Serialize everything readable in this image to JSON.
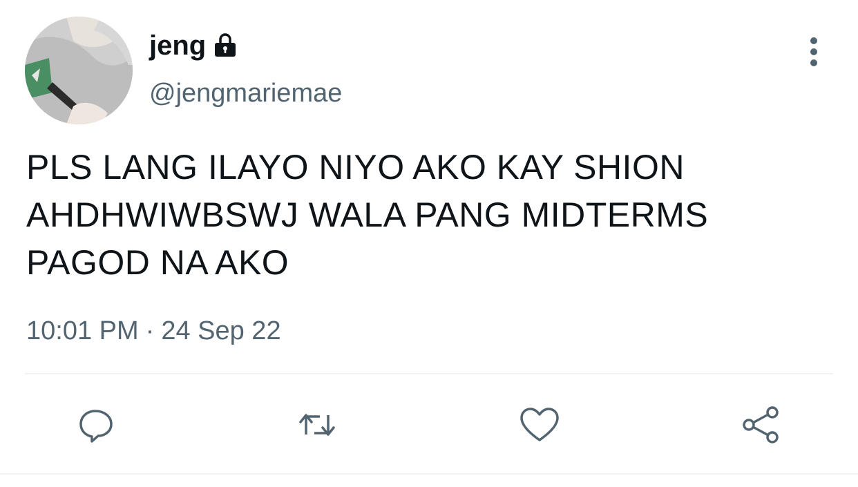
{
  "author": {
    "display_name": "jeng",
    "handle": "@jengmariemae",
    "protected_icon": "lock-icon",
    "avatar_icon": "profile-photo"
  },
  "tweet": {
    "text": "PLS LANG ILAYO NIYO AKO KAY SHION AHDHWIWBSWJ WALA PANG MIDTERMS PAGOD NA AKO",
    "time": "10:01 PM",
    "separator": "·",
    "date": "24 Sep 22"
  },
  "actions": {
    "reply": "reply-icon",
    "retweet": "retweet-icon",
    "like": "like-icon",
    "share": "share-icon",
    "more": "more-icon"
  },
  "colors": {
    "text": "#0f1419",
    "secondary": "#536471",
    "divider": "#eff3f4"
  }
}
